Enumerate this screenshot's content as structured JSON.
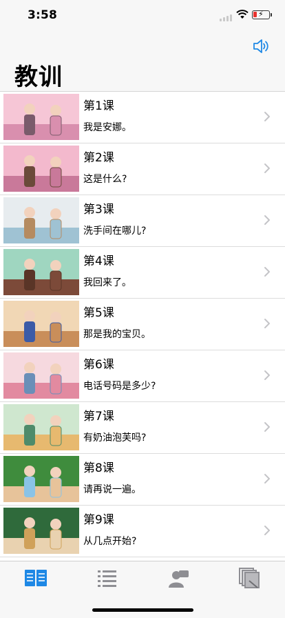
{
  "status_bar": {
    "time": "3:58"
  },
  "nav": {
    "title": "教训",
    "speaker_icon": "speaker-icon"
  },
  "lessons": [
    {
      "title": "第1课",
      "subtitle": "我是安娜。",
      "thumb": "cherry-blossom-scene",
      "colors": [
        "#f6c6d6",
        "#d98fae",
        "#7a5b6b"
      ]
    },
    {
      "title": "第2课",
      "subtitle": "这是什么?",
      "thumb": "park-bench-scene",
      "colors": [
        "#f3b9cd",
        "#c9799a",
        "#6b4a3a"
      ]
    },
    {
      "title": "第3课",
      "subtitle": "洗手间在哪儿?",
      "thumb": "classroom-scene",
      "colors": [
        "#e7ecef",
        "#9fc2d3",
        "#b58b60"
      ]
    },
    {
      "title": "第4课",
      "subtitle": "我回来了。",
      "thumb": "doorway-scene",
      "colors": [
        "#9fd6c0",
        "#7c4a39",
        "#5a3527"
      ]
    },
    {
      "title": "第5课",
      "subtitle": "那是我的宝贝。",
      "thumb": "room-scene",
      "colors": [
        "#f1d7b5",
        "#c98e5a",
        "#3b5ba7"
      ]
    },
    {
      "title": "第6课",
      "subtitle": "电话号码是多少?",
      "thumb": "cafe-scene",
      "colors": [
        "#f6d9df",
        "#e28aa0",
        "#6a8fb8"
      ]
    },
    {
      "title": "第7课",
      "subtitle": "有奶油泡芙吗?",
      "thumb": "bakery-scene",
      "colors": [
        "#cfe7cf",
        "#e7b96f",
        "#4e8b6a"
      ]
    },
    {
      "title": "第8课",
      "subtitle": "请再说一遍。",
      "thumb": "blackboard-scene",
      "colors": [
        "#3f8c3d",
        "#e7c39a",
        "#8ac3e6"
      ]
    },
    {
      "title": "第9课",
      "subtitle": "从几点开始?",
      "thumb": "meeting-scene",
      "colors": [
        "#2f6a3b",
        "#e9d2b0",
        "#d0a15a"
      ]
    }
  ],
  "tab_bar": {
    "tabs": [
      {
        "icon": "open-book-icon",
        "active": true
      },
      {
        "icon": "list-icon",
        "active": false
      },
      {
        "icon": "people-icon",
        "active": false
      },
      {
        "icon": "stacked-pages-icon",
        "active": false
      }
    ],
    "active_color": "#1e88e5",
    "inactive_color": "#8e8e93"
  }
}
